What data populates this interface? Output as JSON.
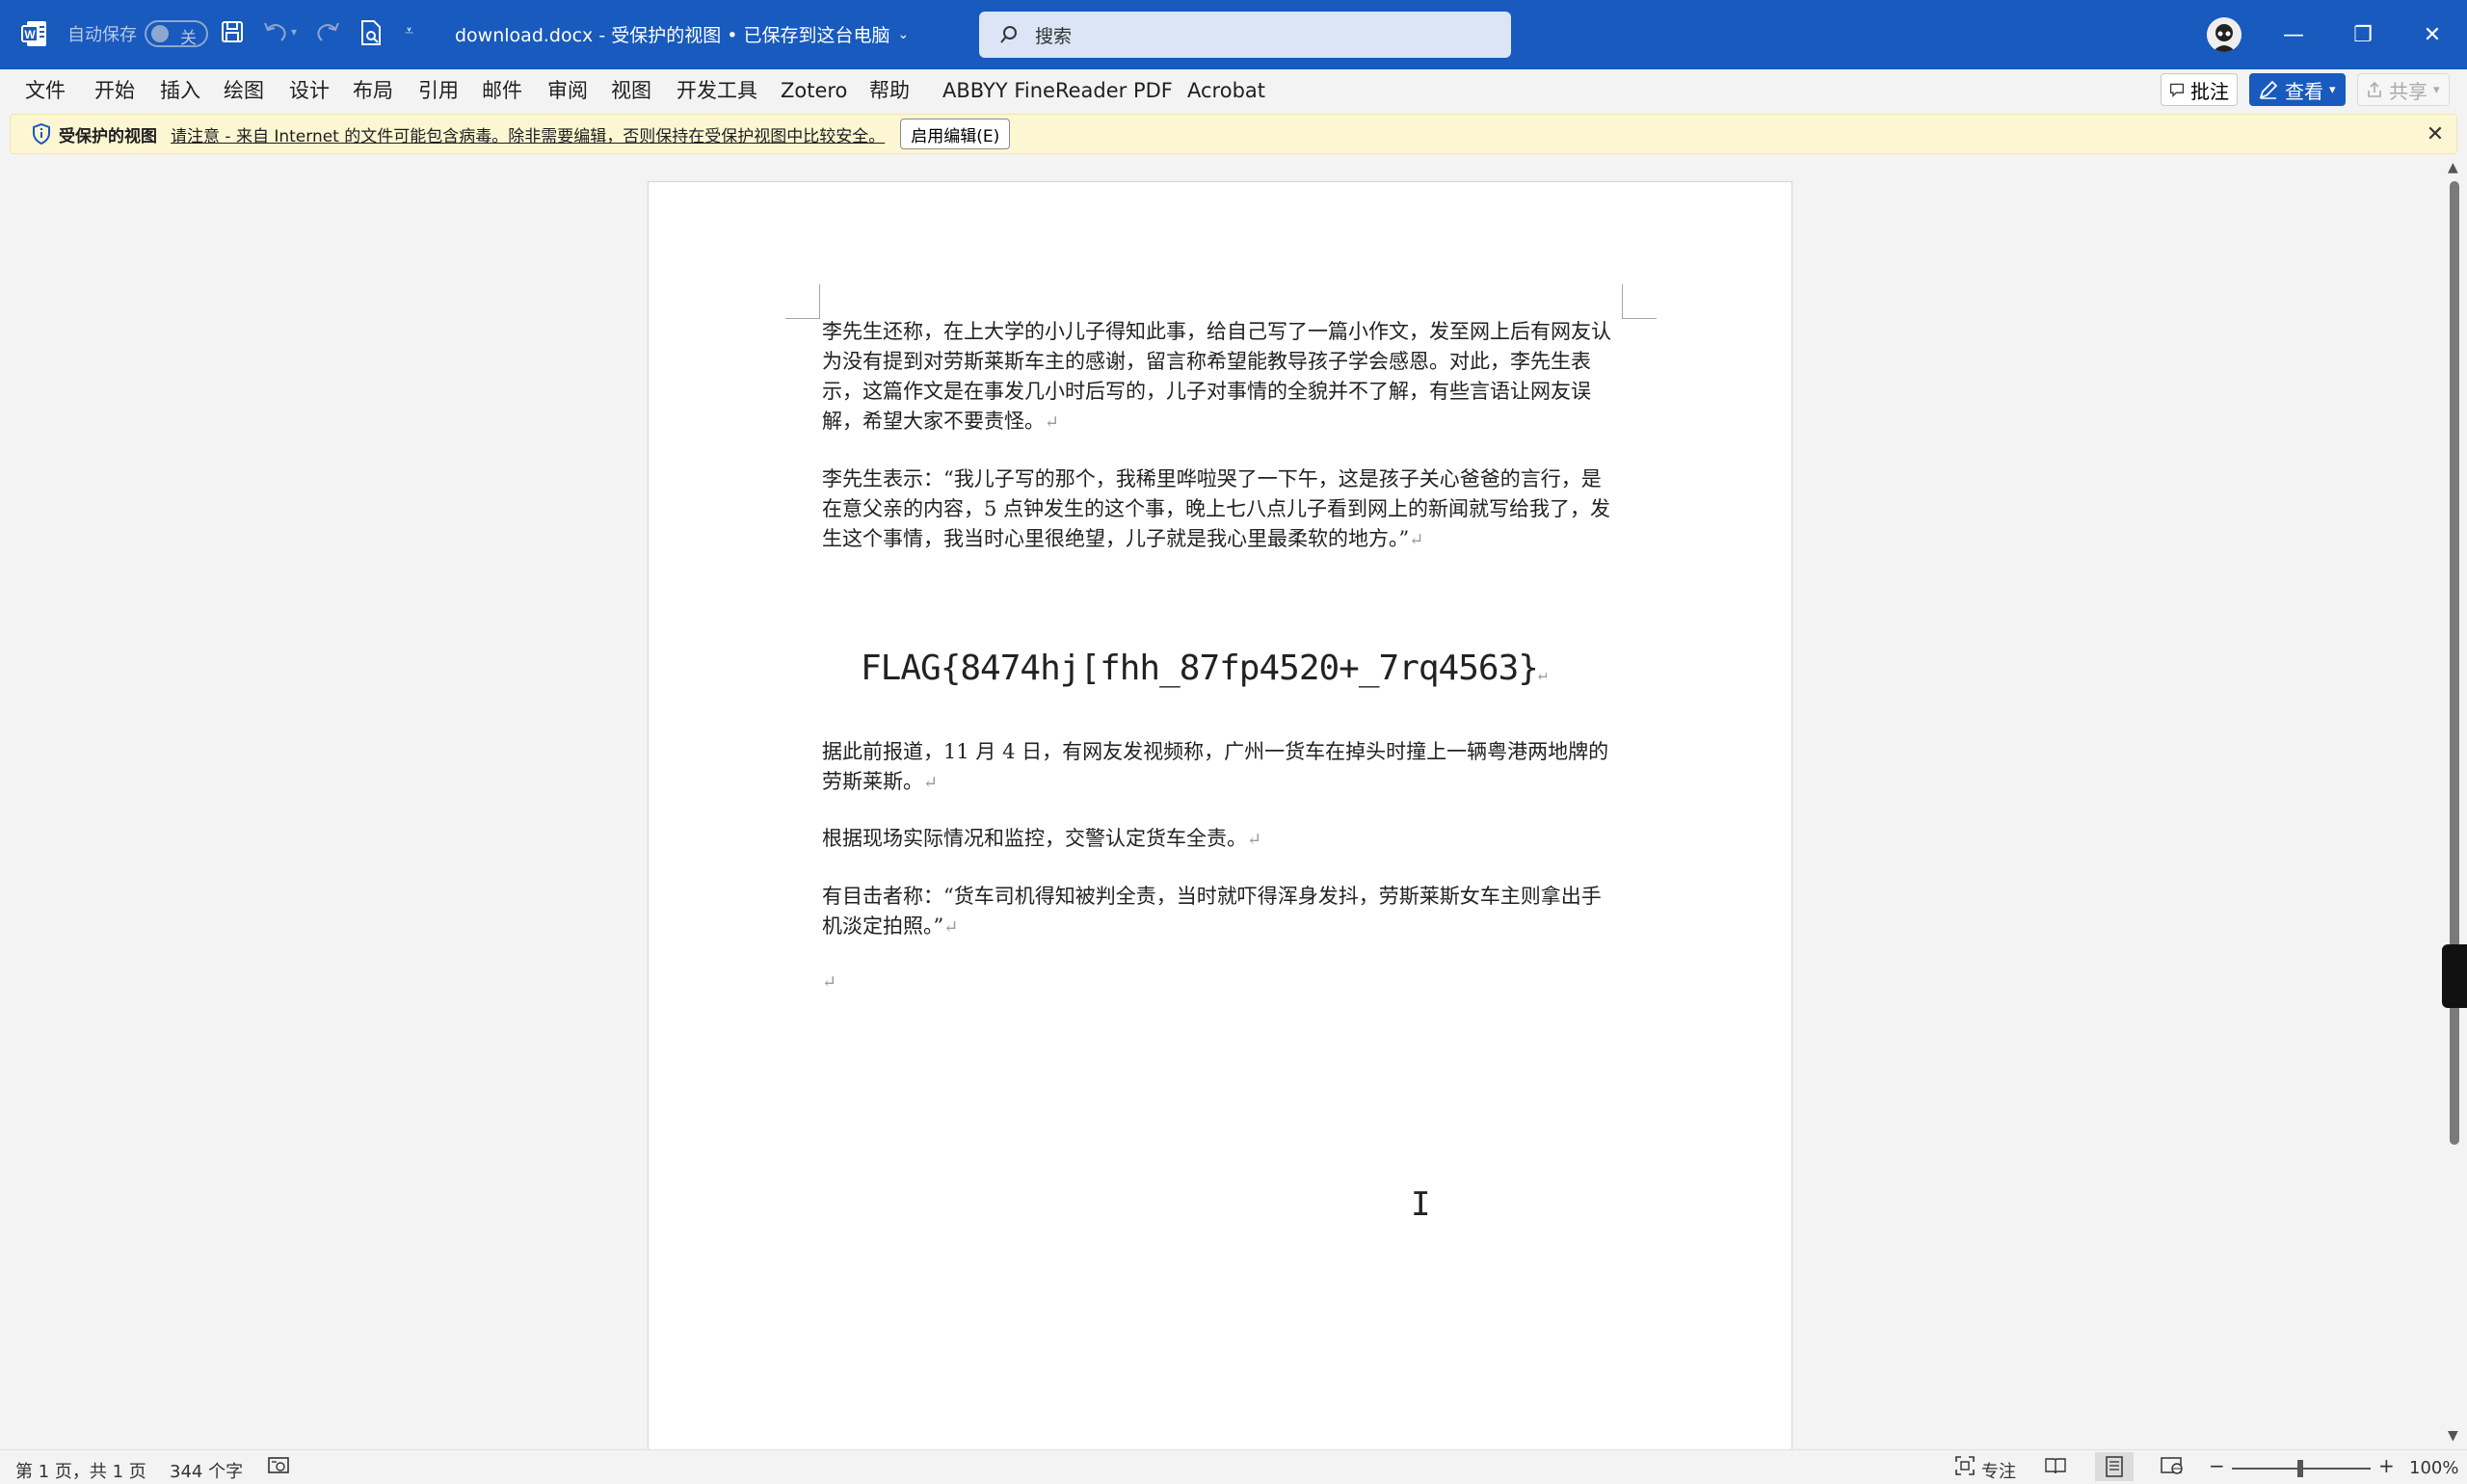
{
  "titlebar": {
    "autosave_label": "自动保存",
    "autosave_state": "关",
    "doc_title": "download.docx - 受保护的视图 • 已保存到这台电脑",
    "search_placeholder": "搜索",
    "minimize": "—",
    "restore": "❐",
    "close": "✕"
  },
  "menu": {
    "items": [
      "文件",
      "开始",
      "插入",
      "绘图",
      "设计",
      "布局",
      "引用",
      "邮件",
      "审阅",
      "视图",
      "开发工具",
      "Zotero",
      "帮助",
      "ABBYY FineReader PDF",
      "Acrobat"
    ],
    "comments": "批注",
    "view": "查看",
    "share": "共享"
  },
  "protected": {
    "title": "受保护的视图",
    "message": "请注意 - 来自 Internet 的文件可能包含病毒。除非需要编辑，否则保持在受保护视图中比较安全。",
    "enable_button": "启用编辑(E)"
  },
  "document": {
    "paragraphs": [
      "李先生还称，在上大学的小儿子得知此事，给自己写了一篇小作文，发至网上后有网友认为没有提到对劳斯莱斯车主的感谢，留言称希望能教导孩子学会感恩。对此，李先生表示，这篇作文是在事发几小时后写的，儿子对事情的全貌并不了解，有些言语让网友误解，希望大家不要责怪。",
      "李先生表示：“我儿子写的那个，我稀里哗啦哭了一下午，这是孩子关心爸爸的言行，是在意父亲的内容，5 点钟发生的这个事，晚上七八点儿子看到网上的新闻就写给我了，发生这个事情，我当时心里很绝望，儿子就是我心里最柔软的地方。”",
      "据此前报道，11 月 4 日，有网友发视频称，广州一货车在掉头时撞上一辆粤港两地牌的劳斯莱斯。",
      "根据现场实际情况和监控，交警认定货车全责。",
      "有目击者称：“货车司机得知被判全责，当时就吓得浑身发抖，劳斯莱斯女车主则拿出手机淡定拍照。”"
    ],
    "flag": "FLAG{8474hj[fhh_87fp4520+_7rq4563}",
    "para_mark": "↵"
  },
  "status": {
    "page": "第 1 页，共 1 页",
    "words": "344 个字",
    "focus": "专注",
    "zoom_minus": "−",
    "zoom_plus": "+",
    "zoom": "100%"
  }
}
